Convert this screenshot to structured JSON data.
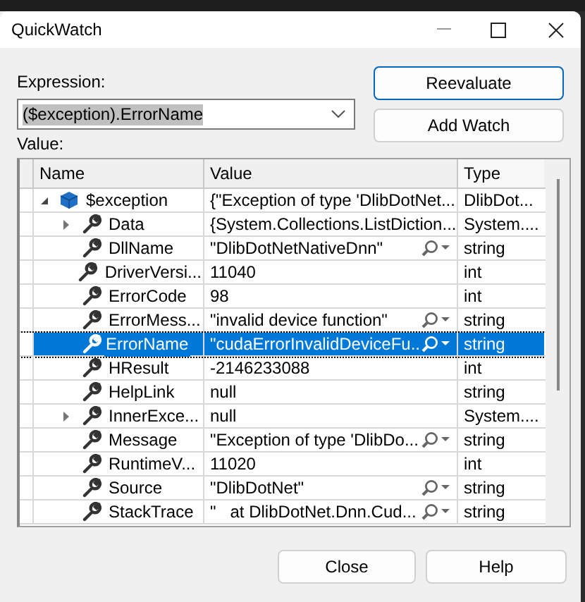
{
  "window": {
    "title": "QuickWatch"
  },
  "expression": {
    "label": "Expression:",
    "value": "($exception).ErrorName"
  },
  "buttons": {
    "reevaluate": "Reevaluate",
    "add_watch": "Add Watch",
    "close": "Close",
    "help": "Help"
  },
  "value_label": "Value:",
  "table": {
    "columns": [
      "Name",
      "Value",
      "Type"
    ],
    "rows": [
      {
        "name": "$exception",
        "value": "{\"Exception of type 'DlibDotNet...",
        "type": "DlibDot...",
        "kind": "object",
        "expanded": true,
        "selected": false,
        "children": [
          {
            "name": "Data",
            "value": "{System.Collections.ListDiction...",
            "type": "System....",
            "kind": "property",
            "expanded": false,
            "selected": false,
            "visualizer": false
          },
          {
            "name": "DllName",
            "value": "\"DlibDotNetNativeDnn\"",
            "type": "string",
            "kind": "property",
            "selected": false,
            "visualizer": true
          },
          {
            "name": "DriverVersi...",
            "value": "11040",
            "type": "int",
            "kind": "property",
            "selected": false,
            "visualizer": false
          },
          {
            "name": "ErrorCode",
            "value": "98",
            "type": "int",
            "kind": "property",
            "selected": false,
            "visualizer": false
          },
          {
            "name": "ErrorMess...",
            "value": "\"invalid device function\"",
            "type": "string",
            "kind": "property",
            "selected": false,
            "visualizer": true
          },
          {
            "name": "ErrorName",
            "value": "\"cudaErrorInvalidDeviceFu...",
            "type": "string",
            "kind": "property",
            "selected": true,
            "visualizer": true
          },
          {
            "name": "HResult",
            "value": "-2146233088",
            "type": "int",
            "kind": "property",
            "selected": false,
            "visualizer": false
          },
          {
            "name": "HelpLink",
            "value": "null",
            "type": "string",
            "kind": "property",
            "selected": false,
            "visualizer": false
          },
          {
            "name": "InnerExce...",
            "value": "null",
            "type": "System....",
            "kind": "property",
            "expanded": false,
            "selected": false,
            "visualizer": false
          },
          {
            "name": "Message",
            "value": "\"Exception of type 'DlibDo...",
            "type": "string",
            "kind": "property",
            "selected": false,
            "visualizer": true
          },
          {
            "name": "RuntimeV...",
            "value": "11020",
            "type": "int",
            "kind": "property",
            "selected": false,
            "visualizer": false
          },
          {
            "name": "Source",
            "value": "\"DlibDotNet\"",
            "type": "string",
            "kind": "property",
            "selected": false,
            "visualizer": true
          },
          {
            "name": "StackTrace",
            "value": "\"   at DlibDotNet.Dnn.Cud...",
            "type": "string",
            "kind": "property",
            "selected": false,
            "visualizer": true
          }
        ]
      }
    ]
  }
}
